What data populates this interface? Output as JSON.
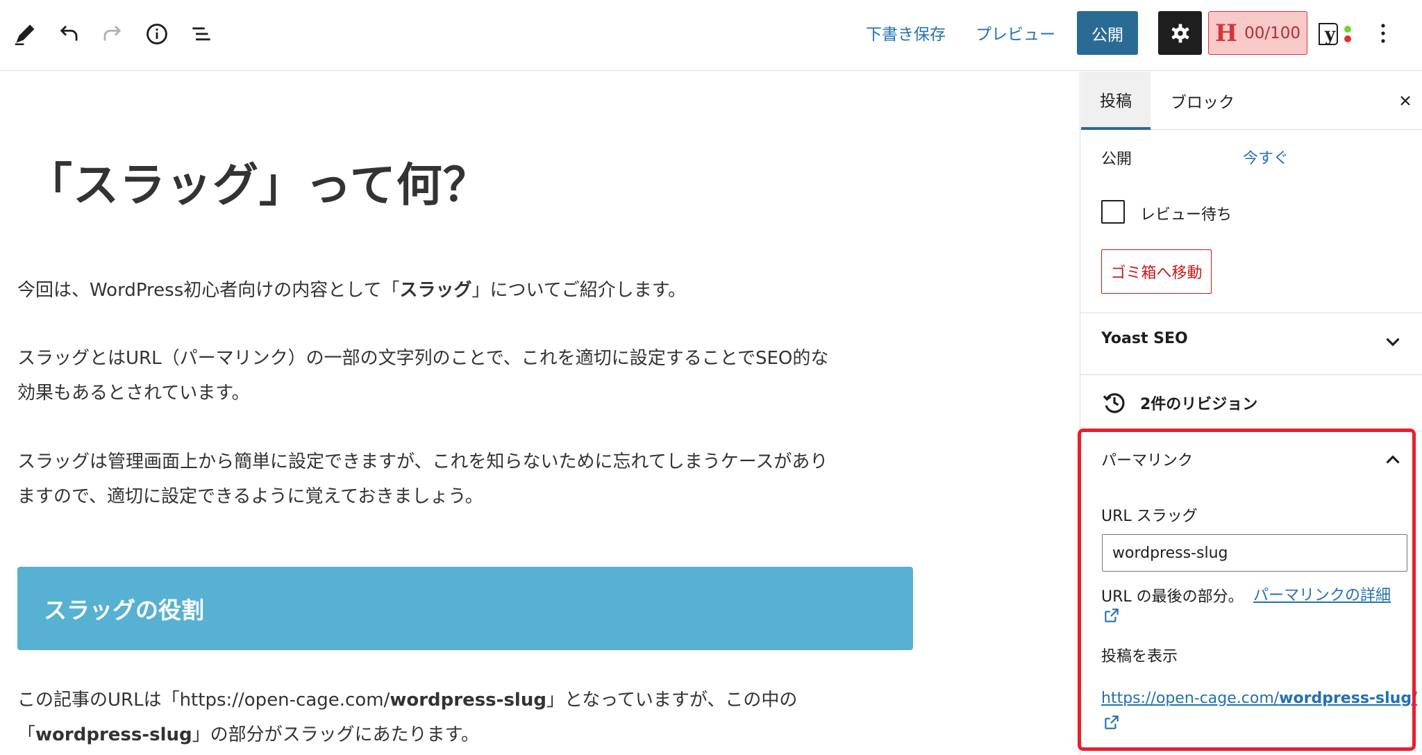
{
  "toolbar": {
    "save_draft": "下書き保存",
    "preview": "プレビュー",
    "publish": "公開",
    "h_logo": "H",
    "h_score": "00/100",
    "yoast_logo": "y",
    "icons": [
      "pencil-icon",
      "undo-icon",
      "redo-icon",
      "info-icon",
      "list-view-icon",
      "gear-icon",
      "more-vertical-icon"
    ]
  },
  "post": {
    "title": "「スラッグ」って何？",
    "paragraph1": {
      "before": "今回は、WordPress初心者向けの内容として「",
      "bold": "スラッグ",
      "after": "」についてご紹介します。"
    },
    "paragraph2_line1": "スラッグとはURL（パーマリンク）の一部の文字列のことで、これを適切に設定することでSEO的な",
    "paragraph2_line2": "効果もあるとされています。",
    "paragraph3_line1": "スラッグは管理画面上から簡単に設定できますが、これを知らないために忘れてしまうケースがあり",
    "paragraph3_line2": "ますので、適切に設定できるように覚えておきましょう。",
    "heading": "スラッグの役割",
    "paragraph4": {
      "l1_before": "この記事のURLは「https://open-cage.com/",
      "l1_bold": "wordpress-slug",
      "l1_after": "」となっていますが、この中の",
      "l2_before": "「",
      "l2_bold": "wordpress-slug",
      "l2_after": "」の部分がスラッグにあたります。"
    }
  },
  "sidebar": {
    "tab_post": "投稿",
    "tab_block": "ブロック",
    "publish_label": "公開",
    "publish_value": "今すぐ",
    "pending_review": "レビュー待ち",
    "pending_review_checked": false,
    "move_to_trash": "ゴミ箱へ移動",
    "yoast_seo": "Yoast SEO",
    "revisions": "2件のリビジョン",
    "permalink": {
      "title": "パーマリンク",
      "url_slug_label": "URL スラッグ",
      "url_slug_value": "wordpress-slug",
      "help_text": "URL の最後の部分。",
      "help_link": "パーマリンクの詳細",
      "view_post_label": "投稿を表示",
      "view_url_prefix": "https://open-cage.com/",
      "view_url_slug": "wordpress-slug/"
    }
  },
  "colors": {
    "accent": "#2271b1",
    "publish_button": "#2a6b96",
    "heading_block": "#56b1d2",
    "highlight": "#e8202a",
    "danger": "#cc1818"
  }
}
